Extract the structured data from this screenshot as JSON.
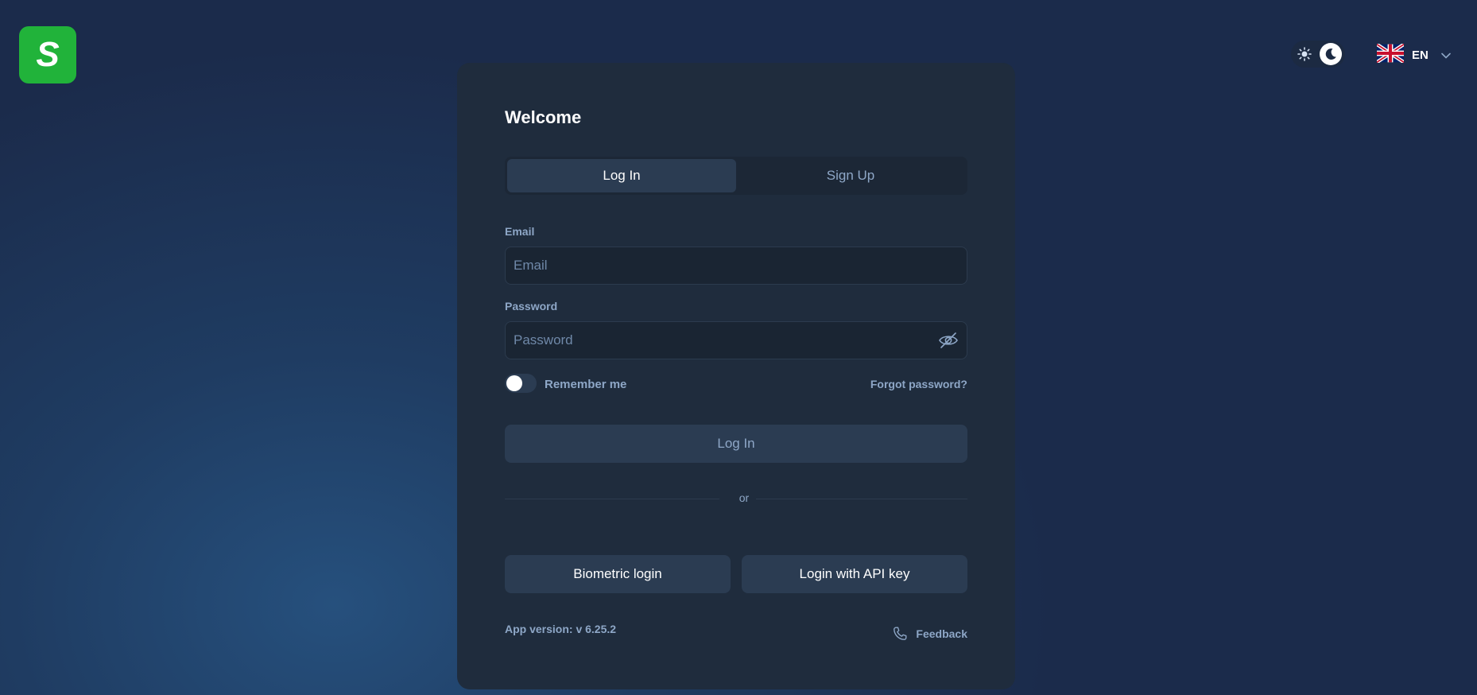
{
  "logo": {
    "text": "S"
  },
  "header": {
    "theme_toggle": {
      "light_icon": "sun-icon",
      "dark_icon": "moon-icon",
      "active": "dark"
    },
    "language": {
      "flag": "uk-flag-icon",
      "code": "EN"
    }
  },
  "card": {
    "title": "Welcome",
    "tabs": [
      {
        "label": "Log In",
        "active": true
      },
      {
        "label": "Sign Up",
        "active": false
      }
    ],
    "email": {
      "label": "Email",
      "placeholder": "Email"
    },
    "password": {
      "label": "Password",
      "placeholder": "Password"
    },
    "remember_me": {
      "label": "Remember me",
      "checked": false
    },
    "forgot_password": "Forgot password?",
    "login_button": "Log In",
    "or_text": "or",
    "biometric_button": "Biometric login",
    "api_key_button": "Login with API key",
    "app_version": "App version: v 6.25.2",
    "feedback": "Feedback"
  },
  "colors": {
    "accent_green": "#21b33a",
    "card_bg": "#1f2c3d",
    "muted_text": "#8ea7c7"
  }
}
